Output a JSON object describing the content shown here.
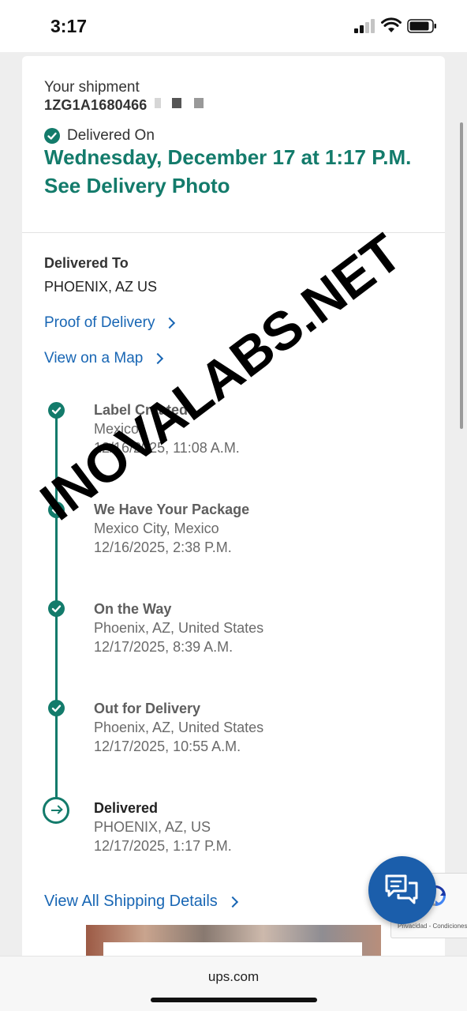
{
  "status_bar": {
    "time": "3:17"
  },
  "shipment": {
    "label": "Your shipment",
    "tracking_number": "1ZG1A1680466",
    "status_label": "Delivered On",
    "delivery_datetime": "Wednesday, December 17 at 1:17 P.M.",
    "delivery_photo_link": "See Delivery Photo"
  },
  "destination": {
    "label": "Delivered To",
    "value": "PHOENIX, AZ US"
  },
  "links": {
    "proof_of_delivery": "Proof of Delivery",
    "view_on_map": "View on a Map",
    "view_all_shipping_details": "View All Shipping Details"
  },
  "timeline": [
    {
      "title": "Label Created",
      "location": "Mexico",
      "datetime": "12/16/2025, 11:08 A.M."
    },
    {
      "title": "We Have Your Package",
      "location": "Mexico City, Mexico",
      "datetime": "12/16/2025, 2:38 P.M."
    },
    {
      "title": "On the Way",
      "location": "Phoenix, AZ, United States",
      "datetime": "12/17/2025, 8:39 A.M."
    },
    {
      "title": "Out for Delivery",
      "location": "Phoenix, AZ, United States",
      "datetime": "12/17/2025, 10:55 A.M."
    },
    {
      "title": "Delivered",
      "location": "PHOENIX, AZ, US",
      "datetime": "12/17/2025, 1:17 P.M."
    }
  ],
  "watermark": "INOVALABS.NET",
  "recaptcha": {
    "text": "Privacidad - Condiciones"
  },
  "browser": {
    "url": "ups.com"
  },
  "colors": {
    "accent_green": "#137b6b",
    "link_blue": "#1866b4",
    "chat_blue": "#1b5eab"
  },
  "icons": {
    "status": [
      "signal-icon",
      "wifi-icon",
      "battery-icon"
    ],
    "chat": "chat-icon",
    "check": "check-icon",
    "chevron": "chevron-right-icon"
  }
}
